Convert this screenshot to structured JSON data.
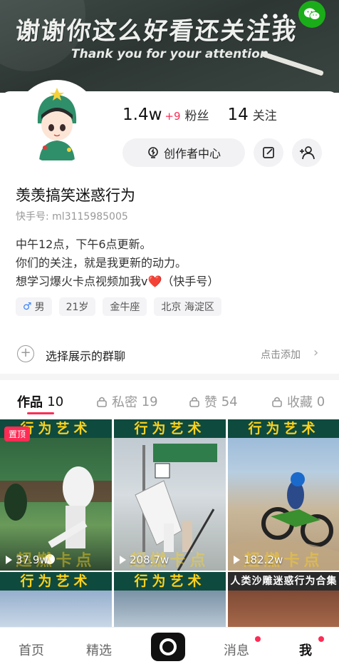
{
  "banner": {
    "title": "谢谢你这么好看还关注我",
    "subtitle": "Thank you for your attention",
    "more_icon": "more-dots-icon",
    "share_icon": "wechat-icon"
  },
  "profile": {
    "followers_count": "1.4w",
    "followers_delta": "+9",
    "followers_label": "粉丝",
    "following_count": "14",
    "following_label": "关注",
    "creator_center_label": "创作者中心",
    "name": "羡羡搞笑迷惑行为",
    "kuaishou_id": "快手号: ml3115985005",
    "bio_lines": [
      "中午12点，下午6点更新。",
      "你们的关注，就是我更新的动力。",
      "想学习爆火卡点视频加我v"
    ],
    "bio_heart": "❤️",
    "bio_suffix": "（快手号）",
    "tags": {
      "gender_symbol": "♂",
      "gender": "男",
      "age": "21岁",
      "zodiac": "金牛座",
      "location": "北京 海淀区"
    }
  },
  "group_chat": {
    "label": "选择展示的群聊",
    "action": "点击添加"
  },
  "tabs": [
    {
      "label": "作品",
      "count": "10"
    },
    {
      "label": "私密",
      "count": "19"
    },
    {
      "label": "赞",
      "count": "54"
    },
    {
      "label": "收藏",
      "count": "0"
    }
  ],
  "videos": [
    {
      "header": "行为艺术",
      "views": "37.9w",
      "pinned": "置顶",
      "watermark": "超燃卡点"
    },
    {
      "header": "行为艺术",
      "views": "208.7w",
      "watermark": "超燃卡点"
    },
    {
      "header": "行为艺术",
      "views": "182.2w",
      "watermark": "超燃卡点"
    },
    {
      "header": "行为艺术"
    },
    {
      "header": "行为艺术"
    },
    {
      "header": "人类沙雕迷惑行为合集"
    }
  ],
  "bottom_nav": {
    "home": "首页",
    "featured": "精选",
    "messages": "消息",
    "me": "我"
  },
  "colors": {
    "accent": "#fe2c55",
    "video_header_bg": "#0f4a3e",
    "video_header_text": "#ffd21a"
  }
}
